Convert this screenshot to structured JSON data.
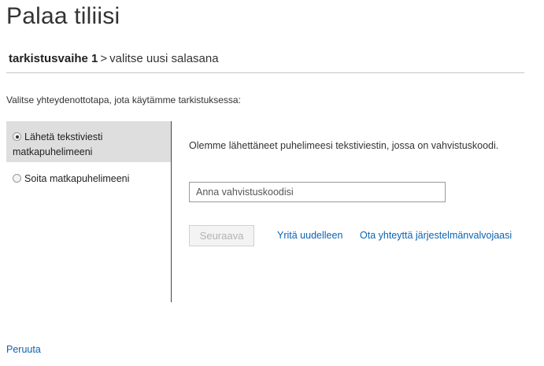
{
  "page": {
    "title": "Palaa tiliisi"
  },
  "breadcrumb": {
    "step": "tarkistusvaihe 1",
    "separator": ">",
    "current": "valitse uusi salasana"
  },
  "prompt": "Valitse yhteydenottotapa, jota käytämme tarkistuksessa:",
  "methods": [
    {
      "line1": "Lähetä tekstiviesti",
      "line2": "matkapuhelimeeni",
      "selected": true
    },
    {
      "line1": "Soita matkapuhelimeeni",
      "selected": false
    }
  ],
  "verify": {
    "message": "Olemme lähettäneet puhelimeesi tekstiviestin, jossa on vahvistuskoodi.",
    "code_value": "",
    "code_placeholder": "Anna vahvistuskoodisi",
    "next_label": "Seuraava",
    "retry_label": "Yritä uudelleen",
    "admin_label": "Ota yhteyttä järjestelmänvalvojaasi"
  },
  "footer": {
    "cancel_label": "Peruuta"
  },
  "colors": {
    "link": "#0a63b3",
    "selected_bg": "#dedede",
    "disabled_text": "#b3b3b3"
  }
}
